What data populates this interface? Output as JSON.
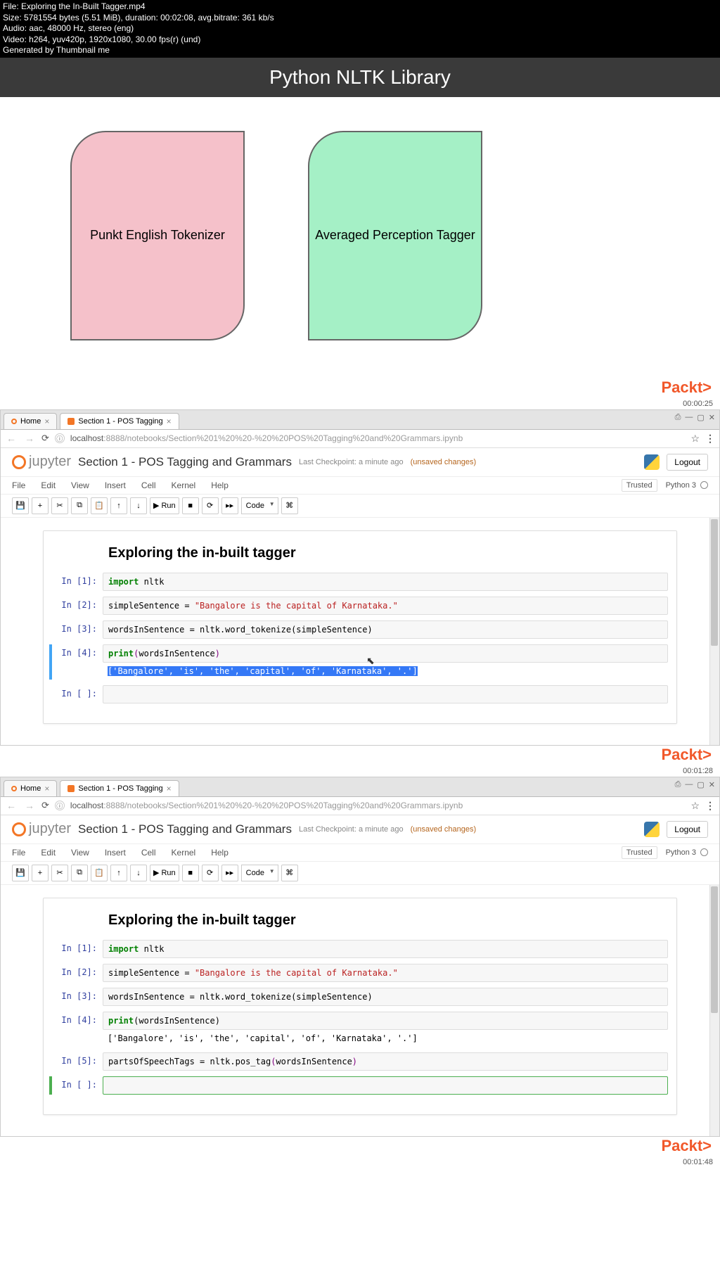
{
  "meta": {
    "file": "File: Exploring the In-Built Tagger.mp4",
    "size": "Size: 5781554 bytes (5.51 MiB), duration: 00:02:08, avg.bitrate: 361 kb/s",
    "audio": "Audio: aac, 48000 Hz, stereo (eng)",
    "video": "Video: h264, yuv420p, 1920x1080, 30.00 fps(r) (und)",
    "gen": "Generated by Thumbnail me"
  },
  "slide": {
    "title": "Python NLTK Library",
    "box1": "Punkt English Tokenizer",
    "box2": "Averaged Perception Tagger"
  },
  "packt": "Packt>",
  "timestamps": {
    "t1": "00:00:25",
    "t2": "00:01:28",
    "t3": "00:01:48"
  },
  "browser": {
    "tab_home": "Home",
    "tab_nb": "Section 1 - POS Tagging",
    "url_host": "localhost",
    "url_rest": ":8888/notebooks/Section%201%20%20-%20%20POS%20Tagging%20and%20Grammars.ipynb",
    "info_char": "ⓘ"
  },
  "jup": {
    "word": "jupyter",
    "title": "Section 1 - POS Tagging and Grammars",
    "checkpoint": "Last Checkpoint: a minute ago",
    "unsaved": "(unsaved changes)",
    "logout": "Logout",
    "trusted": "Trusted",
    "kernel": "Python 3",
    "menu": {
      "file": "File",
      "edit": "Edit",
      "view": "View",
      "insert": "Insert",
      "cell": "Cell",
      "kernel_m": "Kernel",
      "help": "Help"
    },
    "tb": {
      "run": "Run",
      "code": "Code"
    }
  },
  "nb": {
    "heading": "Exploring the in-built tagger",
    "p1": "In [1]:",
    "p2": "In [2]:",
    "p3": "In [3]:",
    "p4": "In [4]:",
    "p5": "In [5]:",
    "pe": "In [ ]:",
    "c1_kw": "import",
    "c1_rest": " nltk",
    "c2_a": "simpleSentence = ",
    "c2_str": "\"Bangalore is the capital of Karnataka.\"",
    "c3": "wordsInSentence = nltk.word_tokenize(simpleSentence)",
    "c4_fn": "print",
    "c4_op": "(",
    "c4_arg": "wordsInSentence",
    "c4_cl": ")",
    "c4_out_sel": "['Bangalore', 'is', 'the', 'capital', 'of', 'Karnataka', '.']",
    "c4_out_plain": "['Bangalore', 'is', 'the', 'capital', 'of', 'Karnataka', '.']",
    "c5_a": "partsOfSpeechTags = nltk.pos_tag",
    "c5_op": "(",
    "c5_arg": "wordsInSentence",
    "c5_cl": ")"
  }
}
